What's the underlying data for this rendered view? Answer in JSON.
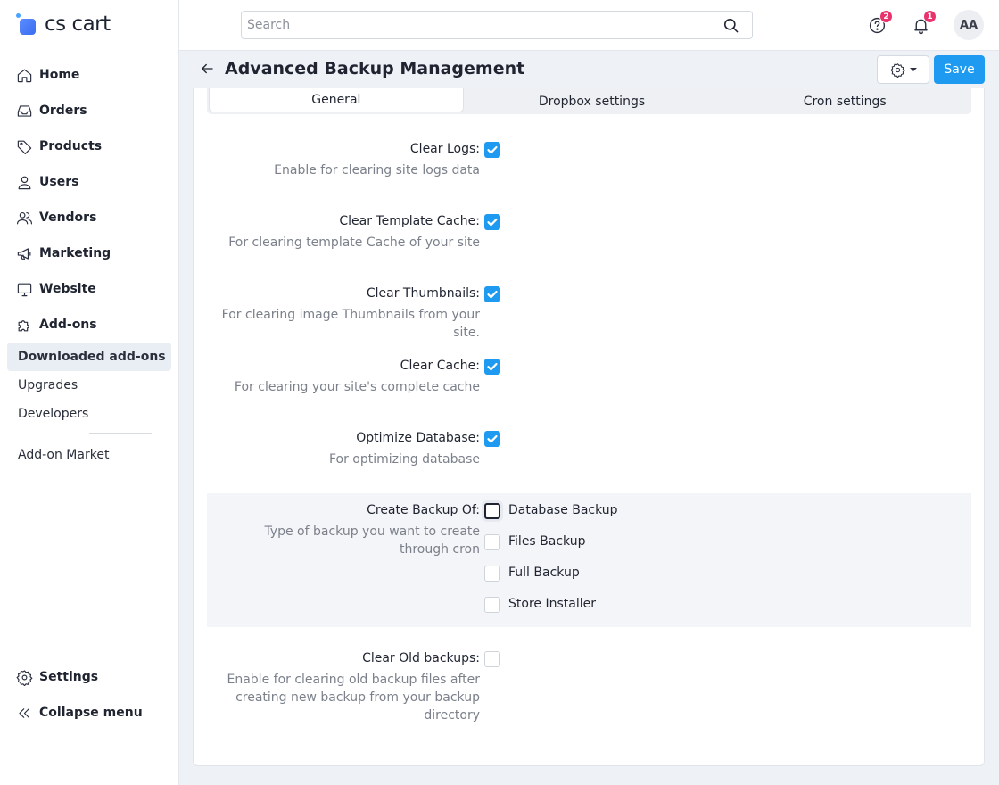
{
  "app": {
    "logo_text": "cs cart"
  },
  "sidebar": {
    "items": [
      {
        "label": "Home",
        "icon": "home-icon"
      },
      {
        "label": "Orders",
        "icon": "inbox-icon"
      },
      {
        "label": "Products",
        "icon": "tag-icon"
      },
      {
        "label": "Users",
        "icon": "user-icon"
      },
      {
        "label": "Vendors",
        "icon": "users-icon"
      },
      {
        "label": "Marketing",
        "icon": "megaphone-icon"
      },
      {
        "label": "Website",
        "icon": "monitor-icon"
      },
      {
        "label": "Add-ons",
        "icon": "puzzle-icon"
      }
    ],
    "subitems": [
      {
        "label": "Downloaded add-ons",
        "active": true
      },
      {
        "label": "Upgrades"
      },
      {
        "label": "Developers"
      },
      {
        "label": "Add-on Market"
      }
    ],
    "bottom": [
      {
        "label": "Settings",
        "icon": "gear-icon"
      },
      {
        "label": "Collapse menu",
        "icon": "double-chevron-left-icon"
      }
    ]
  },
  "topbar": {
    "search_placeholder": "Search",
    "help_badge": "2",
    "notifications_badge": "1",
    "avatar_initials": "AA"
  },
  "page": {
    "title": "Advanced Backup Management",
    "save_label": "Save"
  },
  "tabs": [
    {
      "label": "General",
      "active": true
    },
    {
      "label": "Dropbox settings",
      "active": false
    },
    {
      "label": "Cron settings",
      "active": false
    }
  ],
  "fields": [
    {
      "label": "Clear Logs:",
      "desc": "Enable for clearing site logs data",
      "checked": true
    },
    {
      "label": "Clear Template Cache:",
      "desc": "For clearing template Cache of your site",
      "checked": true
    },
    {
      "label": "Clear Thumbnails:",
      "desc": "For clearing image Thumbnails from your site.",
      "checked": true
    },
    {
      "label": "Clear Cache:",
      "desc": "For clearing your site's complete cache",
      "checked": true
    },
    {
      "label": "Optimize Database:",
      "desc": "For optimizing database",
      "checked": true
    }
  ],
  "backup": {
    "label": "Create Backup Of:",
    "desc": "Type of backup you want to create through cron",
    "options": [
      {
        "label": "Database Backup",
        "checked": false
      },
      {
        "label": "Files Backup",
        "checked": false
      },
      {
        "label": "Full Backup",
        "checked": false
      },
      {
        "label": "Store Installer",
        "checked": false
      }
    ]
  },
  "clear_old": {
    "label": "Clear Old backups:",
    "desc": "Enable for clearing old backup files after creating new backup from your backup directory",
    "checked": false
  },
  "colors": {
    "accent": "#1e9bf0",
    "badge": "#e8336c",
    "active_nav_bg": "#e9edf4"
  }
}
